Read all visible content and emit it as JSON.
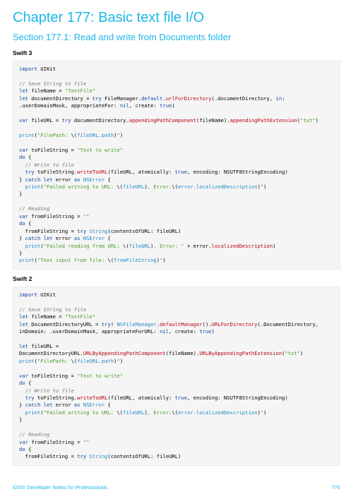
{
  "header": {
    "chapter": "Chapter 177: Basic text file I/O",
    "section": "Section 177.1: Read and write from Documents folder"
  },
  "swift3": {
    "label": "Swift 3",
    "code": "<span class='kw'>import</span> UIKit\n\n<span class='comment'>// Save String to file</span>\n<span class='kw'>let</span> fileName = <span class='string'>\"TextFile\"</span>\n<span class='kw'>let</span> documentDirectory = <span class='kw'>try</span> FileManager.<span class='kw'>default</span>.<span class='method'>urlForDirectory</span>(.documentDirectory, <span class='kw'>in</span>:\n.userDomainMask, appropriateFor: <span class='kw'>nil</span>, create: <span class='kw'>true</span>)\n\n<span class='kw'>var</span> fileURL = <span class='kw'>try</span> documentDirectory.<span class='method'>appendingPathComponent</span>(fileName).<span class='method'>appendingPathExtension</span>(<span class='string'>\"txt\"</span>)\n\n<span class='type'>print</span>(<span class='string'>\"FilePath: </span>\\(<span class='type'>fileURL.path</span>)<span class='string'>\"</span>)\n\n<span class='kw'>var</span> toFileString = <span class='string'>\"Text to write\"</span>\n<span class='kw'>do</span> {\n  <span class='comment'>// Write to file</span>\n  <span class='kw'>try</span> toFileString.<span class='method'>writeToURL</span>(fileURL, atomically: <span class='kw'>true</span>, encoding: NSUTF8StringEncoding)\n} <span class='kw'>catch let</span> error <span class='kw'>as</span> <span class='type'>NSError</span> {\n  <span class='type'>print</span>(<span class='string'>\"Failed writing to URL: </span>\\(<span class='type'>fileURL</span>)<span class='string'>, Error:</span>\\(<span class='type'>error.localizedDescription</span>)<span class='string'>\"</span>)\n}\n\n<span class='comment'>// Reading</span>\n<span class='kw'>var</span> fromFileString = <span class='string'>\"\"</span>\n<span class='kw'>do</span> {\n  fromFileString = <span class='kw'>try</span> <span class='type'>String</span>(contentsOfURL: fileURL)\n} <span class='kw'>catch let</span> error <span class='kw'>as</span> <span class='type'>NSError</span> {\n  <span class='type'>print</span>(<span class='string'>\"Failed reading from URL: </span>\\(<span class='type'>fileURL</span>)<span class='string'>, Error: \"</span> + error.<span class='method'>localizedDescription</span>)\n}\n<span class='type'>print</span>(<span class='string'>\"Text input from file: </span>\\(<span class='type'>fromFileString</span>)<span class='string'>\"</span>)"
  },
  "swift2": {
    "label": "Swift 2",
    "code": "<span class='kw'>import</span> UIKit\n\n<span class='comment'>// Save String to file</span>\n<span class='kw'>let</span> fileName = <span class='string'>\"TextFile\"</span>\n<span class='kw'>let</span> DocumentDirectoryURL = <span class='kw'>try</span>! <span class='type'>NSFileManager</span>.<span class='method'>defaultManager</span>().<span class='method'>URLForDirectory</span>(.DocumentDirectory,\ninDomain: .userDomainMask, appropriateForURL: <span class='kw'>nil</span>, create: <span class='kw'>true</span>)\n\n<span class='kw'>let</span> fileURL =\nDocumentDirectoryURL.<span class='method'>URLByAppendingPathComponent</span>(fileName).<span class='method'>URLByAppendingPathExtension</span>(<span class='string'>\"txt\"</span>)\n<span class='type'>print</span>(<span class='string'>\"FilePath: </span>\\(<span class='type'>fileURL.path</span>)<span class='string'>\"</span>)\n\n<span class='kw'>var</span> toFileString = <span class='string'>\"Text to write\"</span>\n<span class='kw'>do</span> {\n  <span class='comment'>// Write to file</span>\n  <span class='kw'>try</span> toFileString.<span class='method'>writeToURL</span>(fileURL, atomically: <span class='kw'>true</span>, encoding: NSUTF8StringEncoding)\n} <span class='kw'>catch let</span> error <span class='kw'>as</span> <span class='type'>NSError</span> {\n  <span class='type'>print</span>(<span class='string'>\"Failed writing to URL: </span>\\(<span class='type'>fileURL</span>)<span class='string'>, Error:</span>\\(<span class='type'>error.localizedDescription</span>)<span class='string'>\"</span>)\n}\n\n<span class='comment'>// Reading</span>\n<span class='kw'>var</span> fromFileString = <span class='string'>\"\"</span>\n<span class='kw'>do</span> {\n  fromFileString = <span class='kw'>try</span> <span class='type'>String</span>(contentsOfURL: fileURL)"
  },
  "footer": {
    "left": "iOS® Developer Notes for Professionals",
    "right": "776"
  }
}
